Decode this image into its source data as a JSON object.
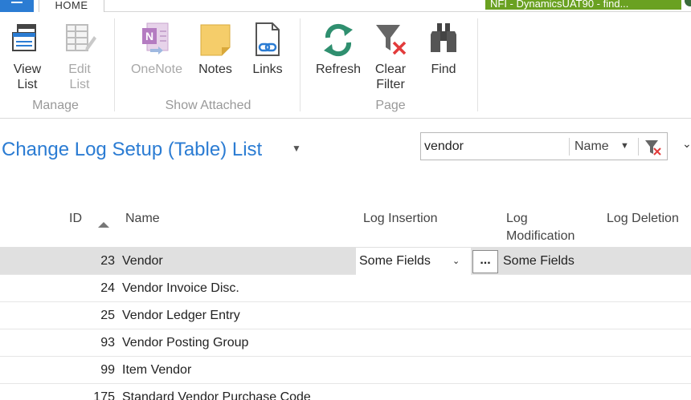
{
  "tabs": {
    "home": "HOME"
  },
  "company": {
    "label": "NFI - DynamicsUAT90 - find..."
  },
  "ribbon": {
    "view_list": "View\nList",
    "edit_list": "Edit\nList",
    "onenote": "OneNote",
    "notes": "Notes",
    "links": "Links",
    "refresh": "Refresh",
    "clear_filter": "Clear\nFilter",
    "find": "Find",
    "groups": {
      "manage": "Manage",
      "show_attached": "Show Attached",
      "page": "Page"
    }
  },
  "page": {
    "title": "Change Log Setup (Table) List"
  },
  "search": {
    "value": "vendor",
    "field": "Name"
  },
  "grid": {
    "headers": {
      "id": "ID",
      "name": "Name",
      "log_insertion": "Log Insertion",
      "log_modification": "Log\nModification",
      "log_deletion": "Log Deletion"
    },
    "rows": [
      {
        "id": "23",
        "name": "Vendor",
        "log_insertion": "Some Fields",
        "log_modification": "Some Fields",
        "selected": true
      },
      {
        "id": "24",
        "name": "Vendor Invoice Disc."
      },
      {
        "id": "25",
        "name": "Vendor Ledger Entry"
      },
      {
        "id": "93",
        "name": "Vendor Posting Group"
      },
      {
        "id": "99",
        "name": "Item Vendor"
      },
      {
        "id": "175",
        "name": "Standard Vendor Purchase Code"
      }
    ],
    "lookup_label": "..."
  },
  "colors": {
    "accent": "#2b7cd3",
    "company": "#6aa121",
    "refresh": "#2f8f6f",
    "selected_row": "#e0e0e0"
  }
}
